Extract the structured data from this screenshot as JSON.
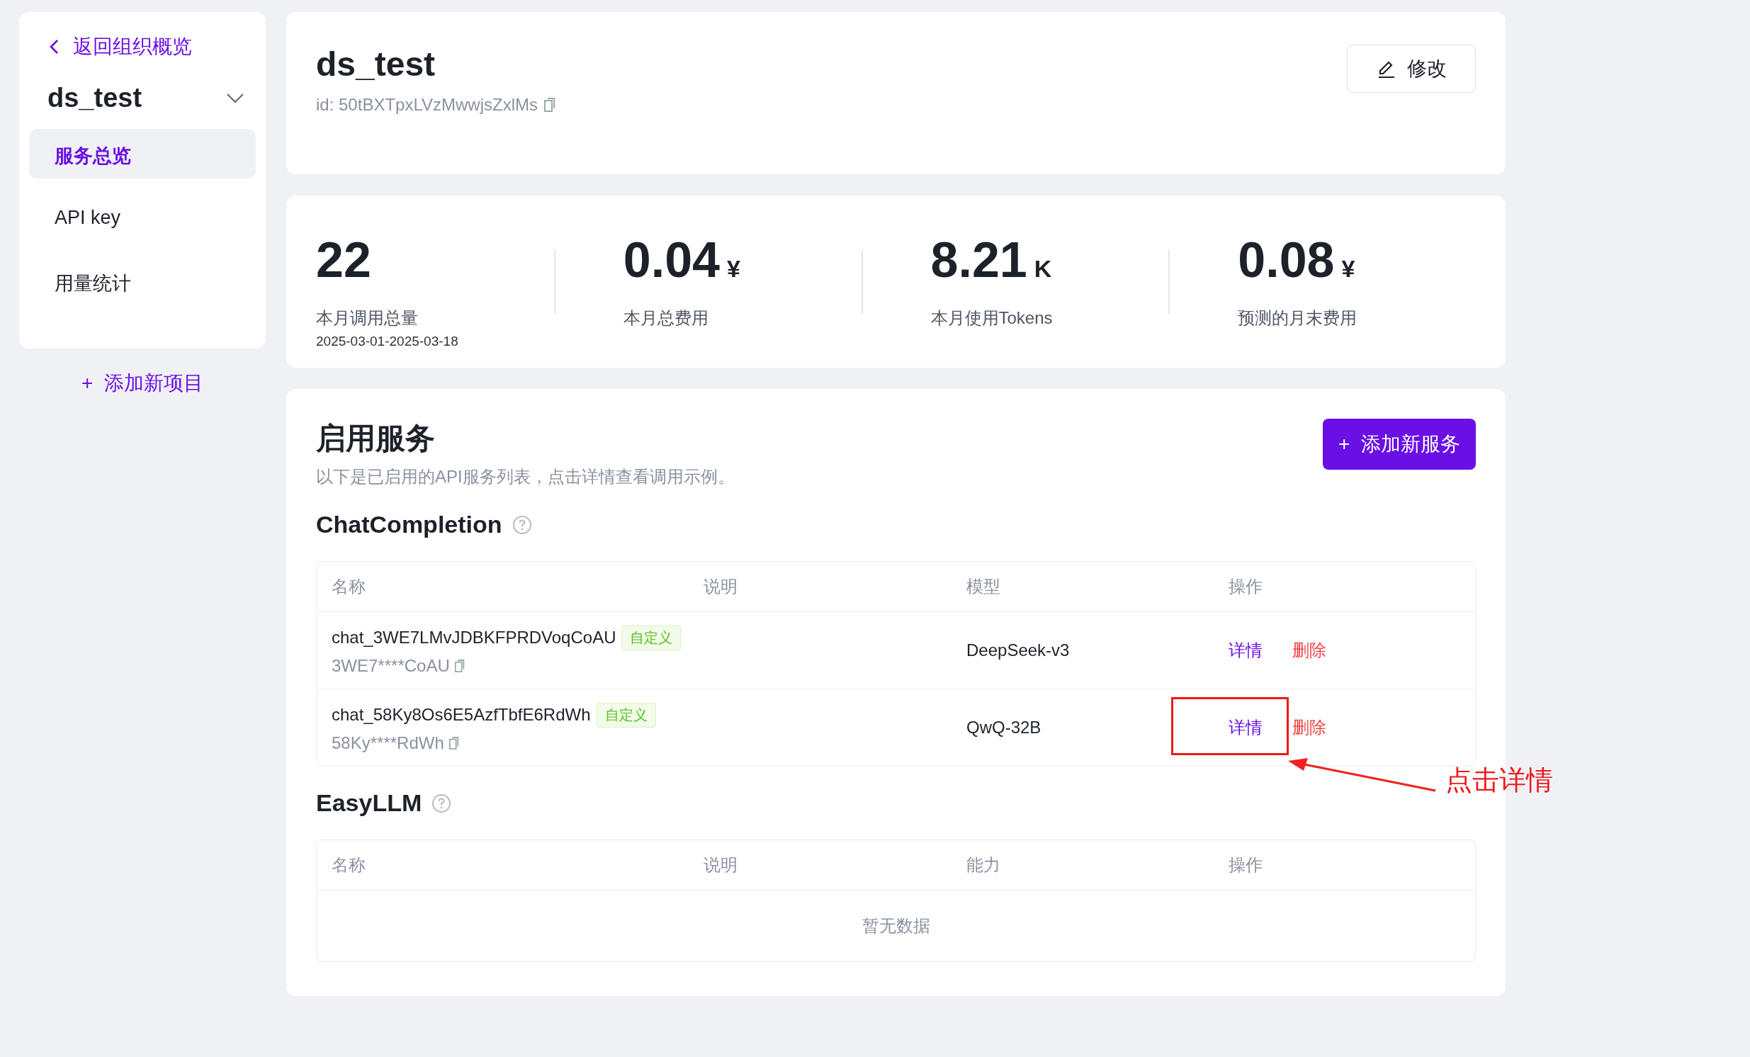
{
  "sidebar": {
    "back_link": "返回组织概览",
    "project": "ds_test",
    "items": [
      {
        "label": "服务总览",
        "selected": true
      },
      {
        "label": "API key",
        "selected": false
      },
      {
        "label": "用量统计",
        "selected": false
      }
    ],
    "add_project": "添加新项目",
    "add_icon": "+"
  },
  "header": {
    "title": "ds_test",
    "id": "id: 50tBXTpxLVzMwwjsZxlMs",
    "edit_button": "修改"
  },
  "stats": [
    {
      "value": "22",
      "label": "本月调用总量",
      "period": "2025-03-01-2025-03-18"
    },
    {
      "value": "0.04",
      "unit": "¥",
      "label": "本月总费用"
    },
    {
      "value": "8.21",
      "unit": "K",
      "label": "本月使用Tokens"
    },
    {
      "value": "0.08",
      "unit": "¥",
      "label": "预测的月末费用"
    }
  ],
  "services": {
    "title": "启用服务",
    "description": "以下是已启用的API服务列表，点击详情查看调用示例。",
    "add_button": "添加新服务",
    "add_icon": "+",
    "groups": [
      {
        "title": "ChatCompletion",
        "columns": [
          "名称",
          "说明",
          "模型",
          "操作"
        ],
        "rows": [
          {
            "name": "chat_3WE7LMvJDBKFPRDVoqCoAU",
            "tag": "自定义",
            "key": "3WE7****CoAU",
            "model": "DeepSeek-v3",
            "detail": "详情",
            "delete": "删除"
          },
          {
            "name": "chat_58Ky8Os6E5AzfTbfE6RdWh",
            "tag": "自定义",
            "key": "58Ky****RdWh",
            "model": "QwQ-32B",
            "detail": "详情",
            "delete": "删除"
          }
        ]
      },
      {
        "title": "EasyLLM",
        "columns": [
          "名称",
          "说明",
          "能力",
          "操作"
        ],
        "empty": "暂无数据"
      }
    ]
  },
  "annotation": {
    "text": "点击详情"
  }
}
